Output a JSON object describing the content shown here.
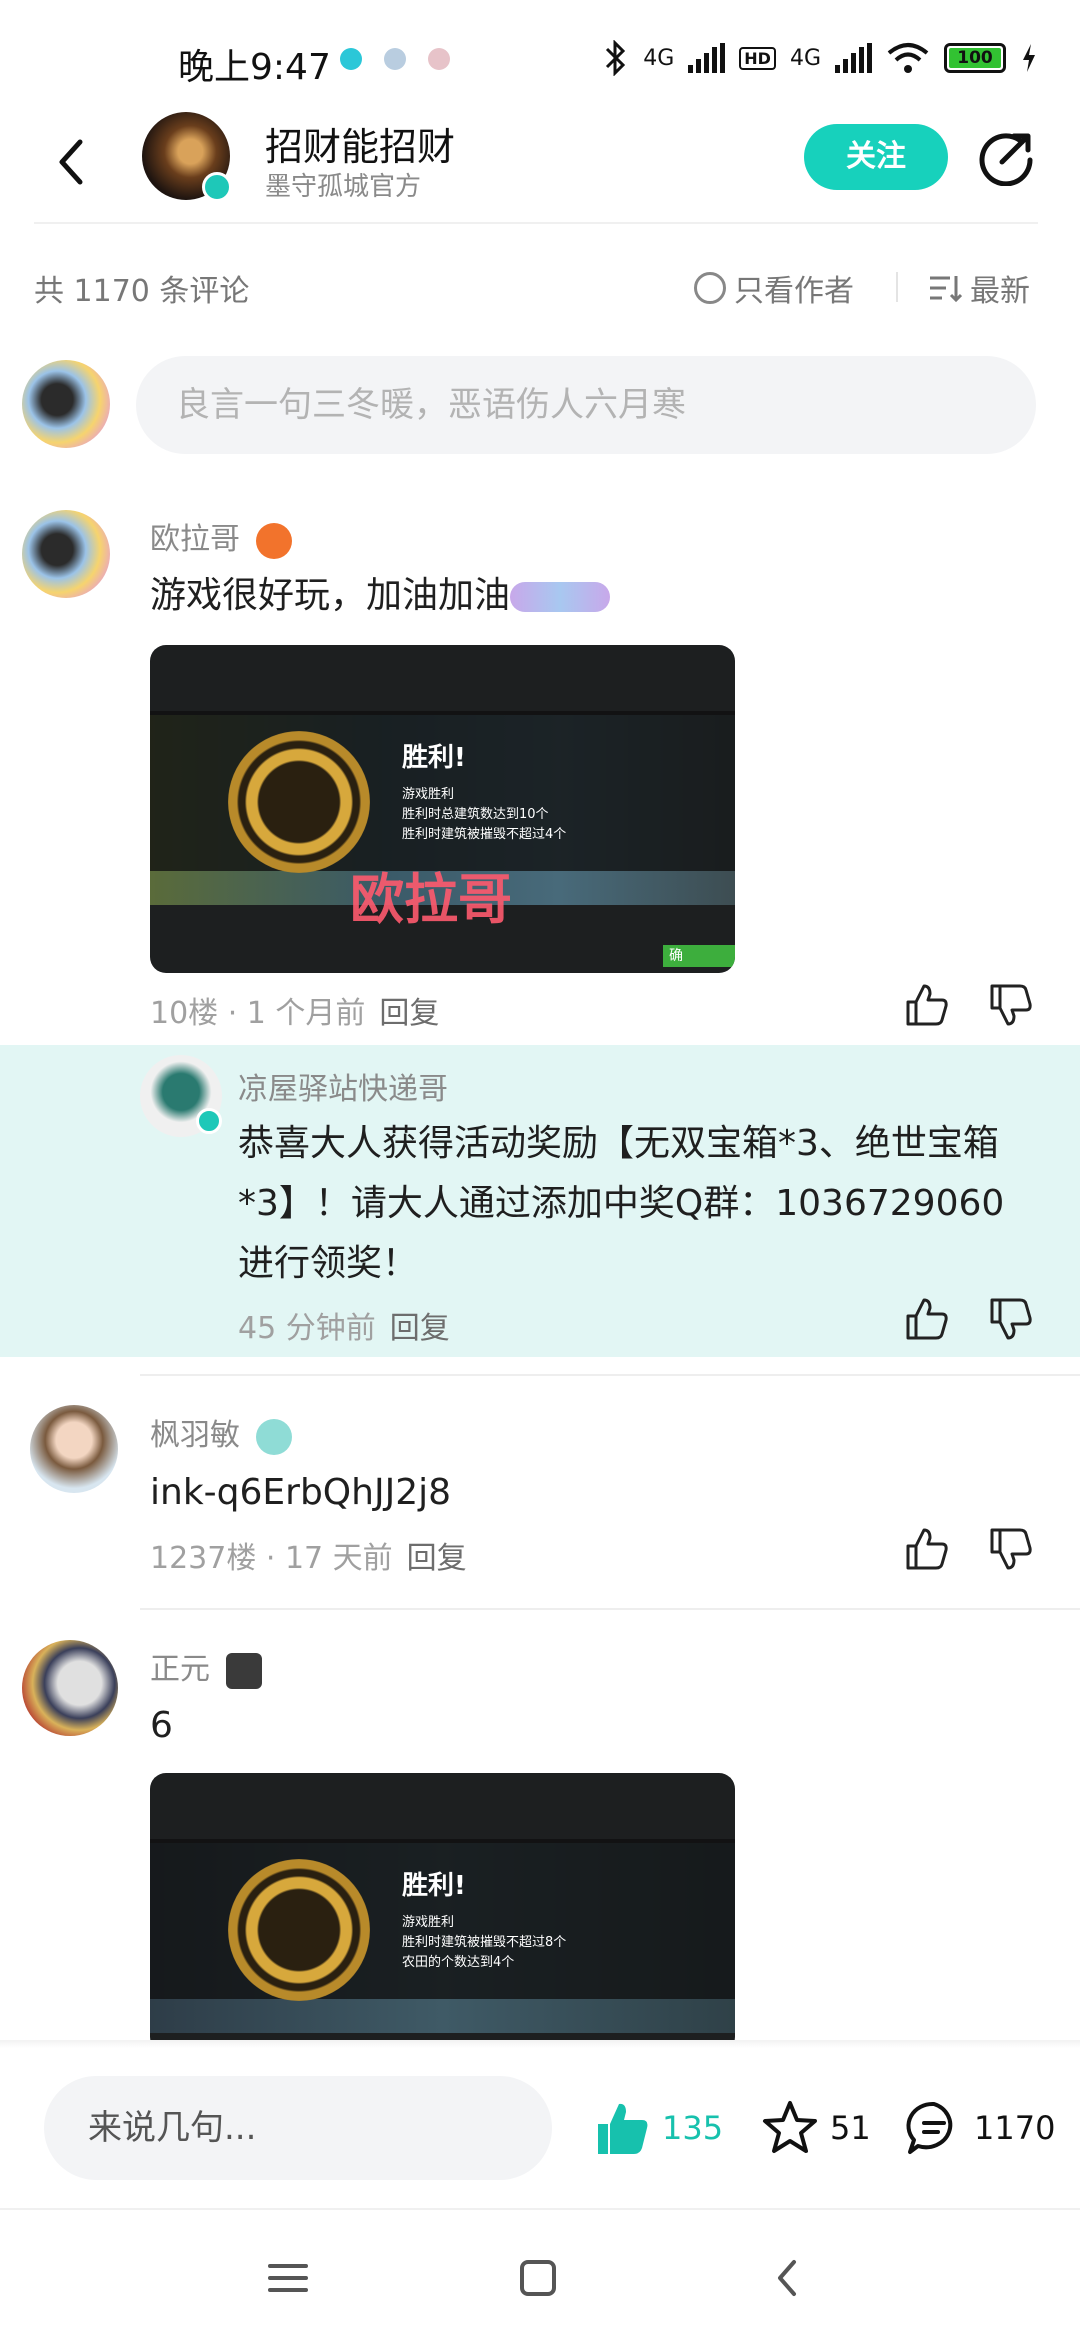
{
  "status_bar": {
    "time": "晚上9:47",
    "network1": "4G",
    "hd": "HD",
    "network2": "4G",
    "battery": "100"
  },
  "header": {
    "name": "招财能招财",
    "subtitle": "墨守孤城官方",
    "follow_label": "关注"
  },
  "filter": {
    "count": "共 1170 条评论",
    "author_only": "只看作者",
    "sort": "最新"
  },
  "compose": {
    "placeholder": "良言一句三冬暖，恶语伤人六月寒"
  },
  "comments": [
    {
      "username": "欧拉哥",
      "text": "游戏很好玩，加油加油",
      "floor": "10楼 · 1 个月前",
      "reply": "回复",
      "screenshot": {
        "title": "胜利!",
        "conditions": [
          "游戏胜利",
          "胜利时总建筑数达到10个",
          "胜利时建筑被摧毁不超过4个"
        ],
        "watermark": "欧拉哥",
        "button": "确"
      }
    },
    {
      "username": "凉屋驿站快递哥",
      "text": "恭喜大人获得活动奖励【无双宝箱*3、绝世宝箱*3】！请大人通过添加中奖Q群：1036729060进行领奖！",
      "floor": "45 分钟前",
      "reply": "回复"
    },
    {
      "username": "枫羽敏",
      "text": "ink-q6ErbQhJJ2j8",
      "floor": "1237楼 · 17 天前",
      "reply": "回复"
    },
    {
      "username": "正元",
      "text": "6",
      "screenshot": {
        "title": "胜利!",
        "conditions": [
          "游戏胜利",
          "胜利时建筑被摧毁不超过8个",
          "农田的个数达到4个"
        ]
      }
    }
  ],
  "bottom": {
    "say_placeholder": "来说几句...",
    "likes": "135",
    "favorites": "51",
    "comments": "1170"
  },
  "colors": {
    "accent": "#17d1bc",
    "reply_bg": "#e2f6f4"
  }
}
